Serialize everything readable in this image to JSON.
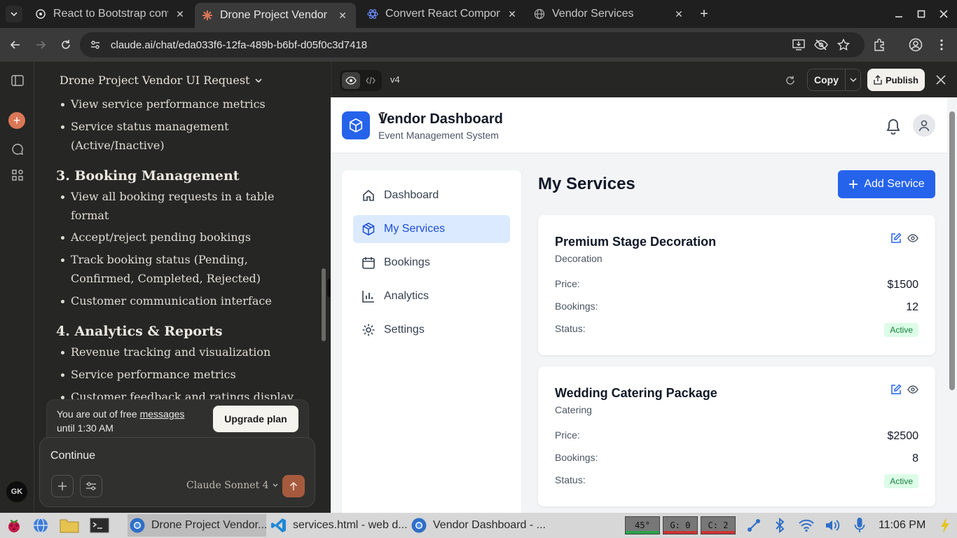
{
  "browser": {
    "tabs": [
      {
        "title": "React to Bootstrap conv",
        "active": false
      },
      {
        "title": "Drone Project Vendor UI",
        "active": true
      },
      {
        "title": "Convert React Compone",
        "active": false
      },
      {
        "title": "Vendor Services",
        "active": false
      }
    ],
    "url": "claude.ai/chat/eda033f6-12fa-489b-b6bf-d05f0c3d7418"
  },
  "chat": {
    "title": "Drone Project Vendor UI Request",
    "items": [
      {
        "type": "bullet",
        "text": "View service performance metrics"
      },
      {
        "type": "bullet",
        "text": "Service status management (Active/Inactive)"
      },
      {
        "type": "heading",
        "text": "3. Booking Management"
      },
      {
        "type": "bullet",
        "text": "View all booking requests in a table format"
      },
      {
        "type": "bullet",
        "text": "Accept/reject pending bookings"
      },
      {
        "type": "bullet",
        "text": "Track booking status (Pending, Confirmed, Completed, Rejected)"
      },
      {
        "type": "bullet",
        "text": "Customer communication interface"
      },
      {
        "type": "heading",
        "text": "4. Analytics & Reports"
      },
      {
        "type": "bullet",
        "text": "Revenue tracking and visualization"
      },
      {
        "type": "bullet",
        "text": "Service performance metrics"
      },
      {
        "type": "bullet",
        "text": "Customer feedback and ratings display"
      }
    ],
    "limit_text_pre": "You are out of free ",
    "limit_link": "messages",
    "limit_text_post": "until 1:30 AM",
    "upgrade_label": "Upgrade plan",
    "composer_text": "Continue",
    "model": "Claude Sonnet 4",
    "user_initials": "GK"
  },
  "artifact": {
    "version": "v4",
    "copy_label": "Copy",
    "publish_label": "Publish"
  },
  "app": {
    "title": "Vendor Dashboard",
    "subtitle": "Event Management System",
    "nav": [
      {
        "label": "Dashboard",
        "icon": "home-icon",
        "active": false
      },
      {
        "label": "My Services",
        "icon": "package-icon",
        "active": true
      },
      {
        "label": "Bookings",
        "icon": "calendar-icon",
        "active": false
      },
      {
        "label": "Analytics",
        "icon": "bar-chart-icon",
        "active": false
      },
      {
        "label": "Settings",
        "icon": "gear-icon",
        "active": false
      }
    ],
    "page_title": "My Services",
    "add_label": "Add Service",
    "price_label": "Price:",
    "bookings_label": "Bookings:",
    "status_label": "Status:",
    "services": [
      {
        "name": "Premium Stage Decoration",
        "category": "Decoration",
        "price": "$1500",
        "bookings": "12",
        "status": "Active"
      },
      {
        "name": "Wedding Catering Package",
        "category": "Catering",
        "price": "$2500",
        "bookings": "8",
        "status": "Active"
      }
    ],
    "accent": "#2563eb"
  },
  "taskbar": {
    "windows": [
      {
        "title": "Drone Project Vendor...",
        "active": true
      },
      {
        "title": "services.html - web d...",
        "active": false
      },
      {
        "title": "Vendor Dashboard - ...",
        "active": false
      }
    ],
    "temp": "45°",
    "gpu": "G:  0",
    "cpu": "C:  2",
    "clock": "11:06 PM"
  }
}
